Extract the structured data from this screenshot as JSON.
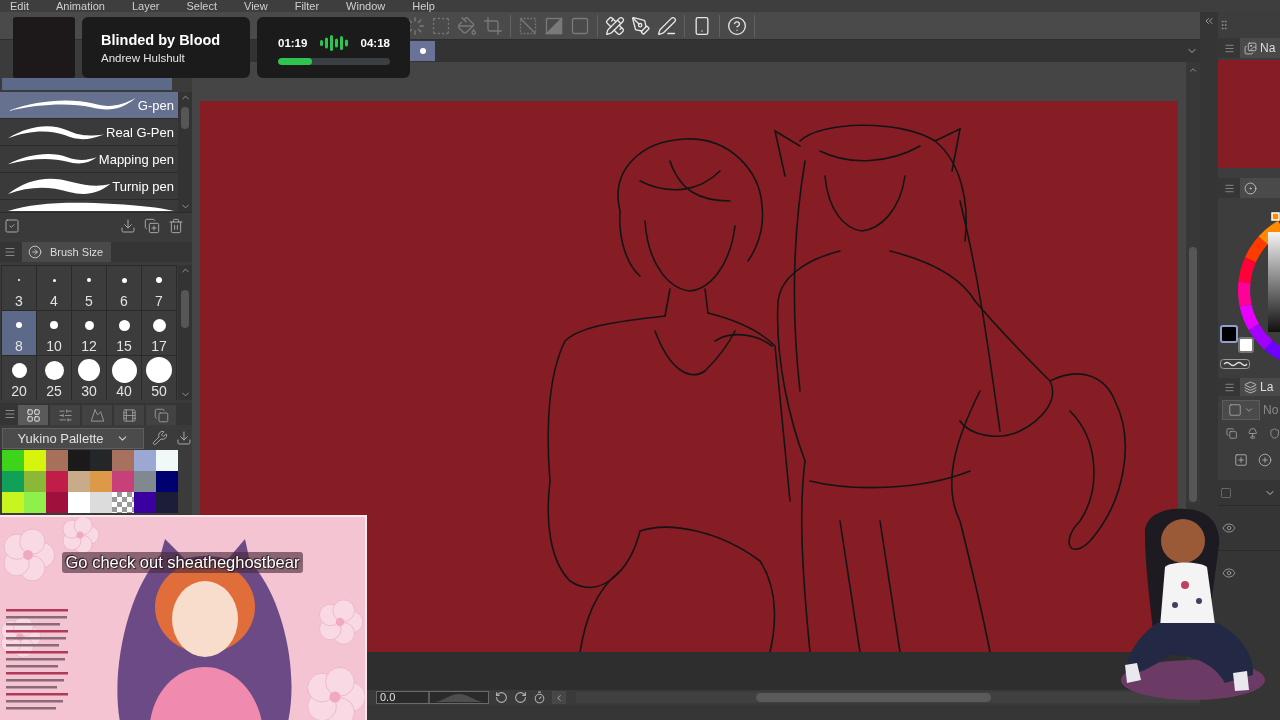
{
  "menu": [
    "Edit",
    "Animation",
    "Layer",
    "Select",
    "View",
    "Filter",
    "Window",
    "Help"
  ],
  "toolbar": [
    {
      "disabled": true
    },
    {
      "disabled": true
    },
    {
      "disabled": true
    },
    {
      "disabled": true
    },
    {
      "disabled": true
    },
    {
      "disabled": true
    },
    {
      "disabled": true
    },
    {
      "disabled": false
    },
    {
      "disabled": false
    },
    {
      "disabled": false
    },
    {
      "disabled": false
    },
    {
      "disabled": false
    }
  ],
  "now_playing": {
    "title": "Blinded by Blood",
    "artist": "Andrew Hulshult",
    "elapsed": "01:19",
    "duration": "04:18",
    "level": 0.3
  },
  "sub_tools": [
    {
      "label": "G-pen",
      "selected": true
    },
    {
      "label": "Real G-Pen",
      "selected": false
    },
    {
      "label": "Mapping pen",
      "selected": false
    },
    {
      "label": "Turnip pen",
      "selected": false
    },
    {
      "selected": false
    }
  ],
  "brush_size": {
    "title": "Brush Size",
    "sizes": [
      {
        "label": "3",
        "selected": false
      },
      {
        "label": "4",
        "selected": false
      },
      {
        "label": "5",
        "selected": false
      },
      {
        "label": "6",
        "selected": false
      },
      {
        "label": "7",
        "selected": false
      },
      {
        "label": "8",
        "selected": true
      },
      {
        "label": "10",
        "selected": false
      },
      {
        "label": "12",
        "selected": false
      },
      {
        "label": "15",
        "selected": false
      },
      {
        "label": "17",
        "selected": false
      },
      {
        "label": "20",
        "selected": false
      },
      {
        "label": "25",
        "selected": false
      },
      {
        "label": "30",
        "selected": false
      },
      {
        "label": "40",
        "selected": false
      },
      {
        "label": "50",
        "selected": false
      }
    ]
  },
  "palette_tabs": [
    {
      "selected": true
    },
    {
      "selected": false
    },
    {
      "selected": false
    },
    {
      "selected": false
    },
    {
      "selected": false
    }
  ],
  "palette": {
    "name": "Yukino Pallette",
    "swatches": [
      {
        "kind": "color",
        "color": "#3ed41a"
      },
      {
        "kind": "color",
        "color": "#d6f50e"
      },
      {
        "kind": "color",
        "color": "#a6705a"
      },
      {
        "kind": "color",
        "color": "#1a1a1a"
      },
      {
        "kind": "color",
        "color": "#23272a"
      },
      {
        "kind": "color",
        "color": "#a8705e"
      },
      {
        "kind": "color",
        "color": "#9ca8d4"
      },
      {
        "kind": "color",
        "color": "#f0f8f8"
      },
      {
        "kind": "color",
        "color": "#10a058"
      },
      {
        "kind": "color",
        "color": "#8cb838"
      },
      {
        "kind": "color",
        "color": "#c01e48"
      },
      {
        "kind": "color",
        "color": "#c8ac8a"
      },
      {
        "kind": "color",
        "color": "#dc9a48"
      },
      {
        "kind": "color",
        "color": "#c8407a"
      },
      {
        "kind": "color",
        "color": "#808890"
      },
      {
        "kind": "color",
        "color": "#000070"
      },
      {
        "kind": "color",
        "color": "#c8f520"
      },
      {
        "kind": "color",
        "color": "#8ef04a"
      },
      {
        "kind": "color",
        "color": "#a0103c"
      },
      {
        "kind": "color",
        "color": "#ffffff"
      },
      {
        "kind": "color",
        "color": "#dcdcdc"
      },
      {
        "kind": "transparent"
      },
      {
        "kind": "color",
        "color": "#3a00a0"
      },
      {
        "kind": "color",
        "color": "#1c1e38"
      }
    ]
  },
  "canvas_tab": {
    "selected": true
  },
  "bottom_bar": {
    "rotation": "0.0"
  },
  "navigator": {
    "tab": "Na"
  },
  "color_panel": {
    "swatches": [
      {
        "color": "#000000",
        "selected": true
      },
      {
        "color": "#ffffff",
        "selected": false
      }
    ]
  },
  "layer_panel": {
    "tab": "La",
    "blend_mode": "No",
    "layers": [
      {
        "visible": true
      },
      {
        "visible": true
      }
    ]
  },
  "stream_overlay": {
    "caption": "Go check out sheatheghostbear"
  }
}
